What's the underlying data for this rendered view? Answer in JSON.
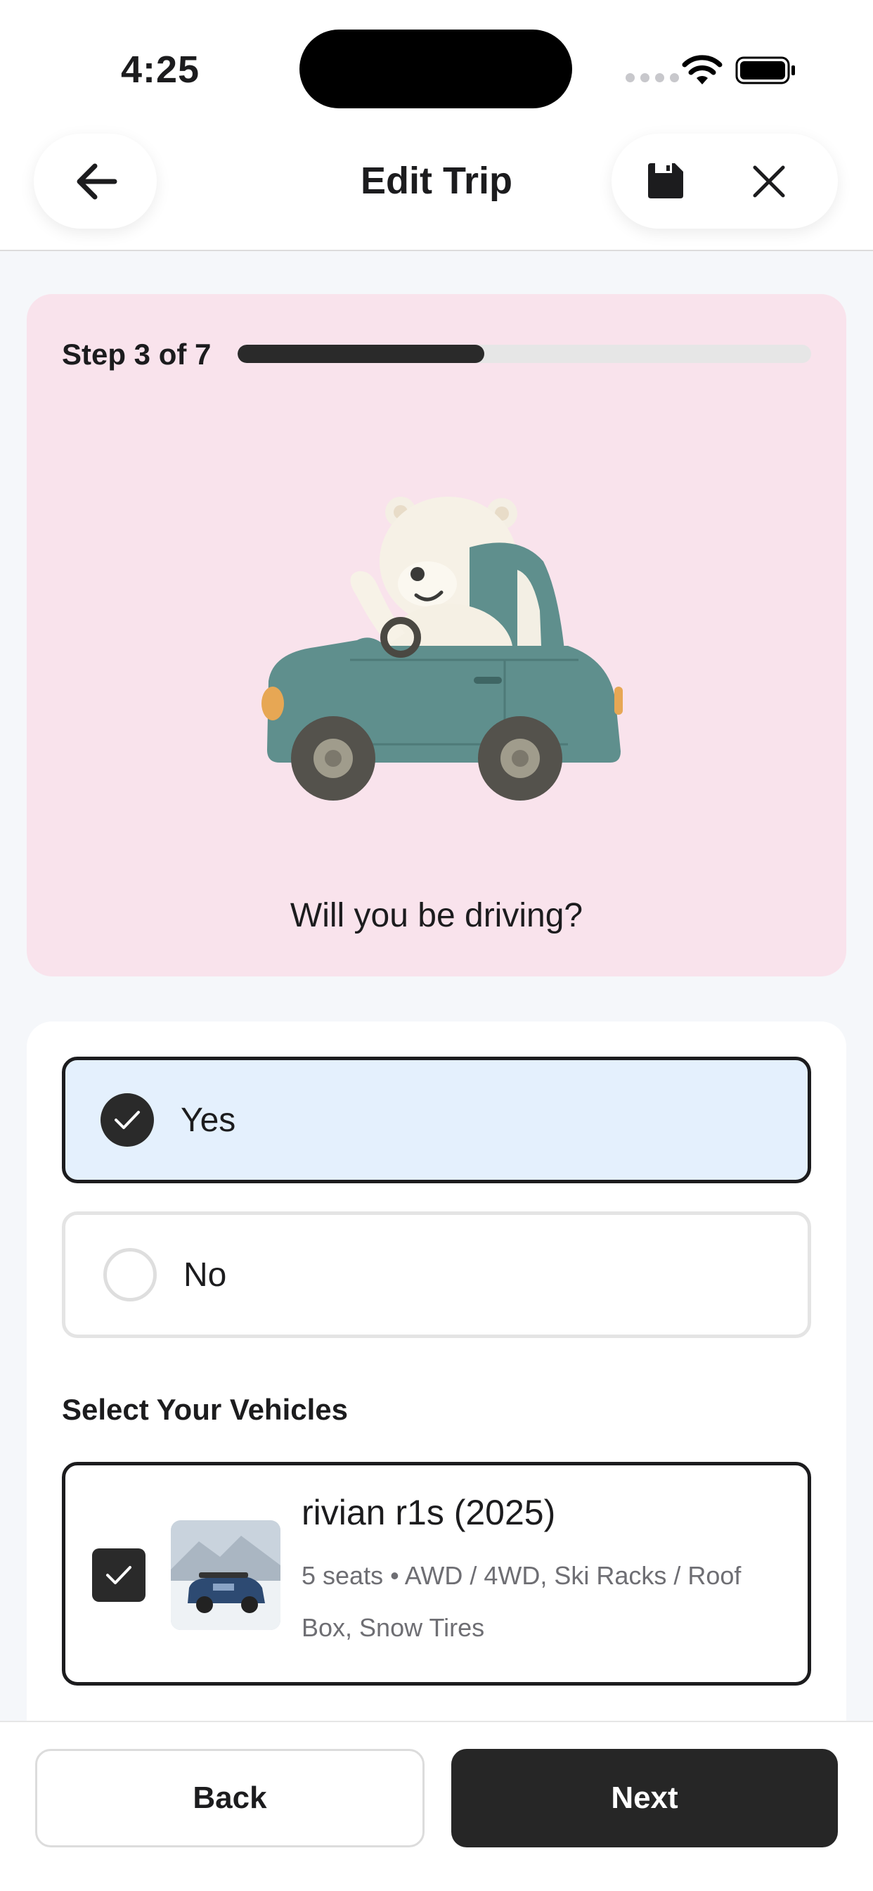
{
  "status_bar": {
    "time": "4:25"
  },
  "header": {
    "title": "Edit Trip",
    "icons": [
      "back-arrow-icon",
      "save-icon",
      "close-icon"
    ]
  },
  "hero": {
    "step_label": "Step 3 of 7",
    "progress_fraction": 0.43,
    "question": "Will you be driving?",
    "background_color": "#f9e3ec"
  },
  "options": {
    "yes_label": "Yes",
    "no_label": "No",
    "selected": "Yes"
  },
  "vehicles": {
    "section_title": "Select Your Vehicles",
    "items": [
      {
        "name": "rivian r1s (2025)",
        "details": "5 seats • AWD / 4WD, Ski Racks / Roof Box, Snow Tires",
        "selected": true
      }
    ]
  },
  "footer": {
    "back_label": "Back",
    "next_label": "Next"
  },
  "colors": {
    "accent_dark": "#262626",
    "selected_option_bg": "#e4f0fd"
  }
}
